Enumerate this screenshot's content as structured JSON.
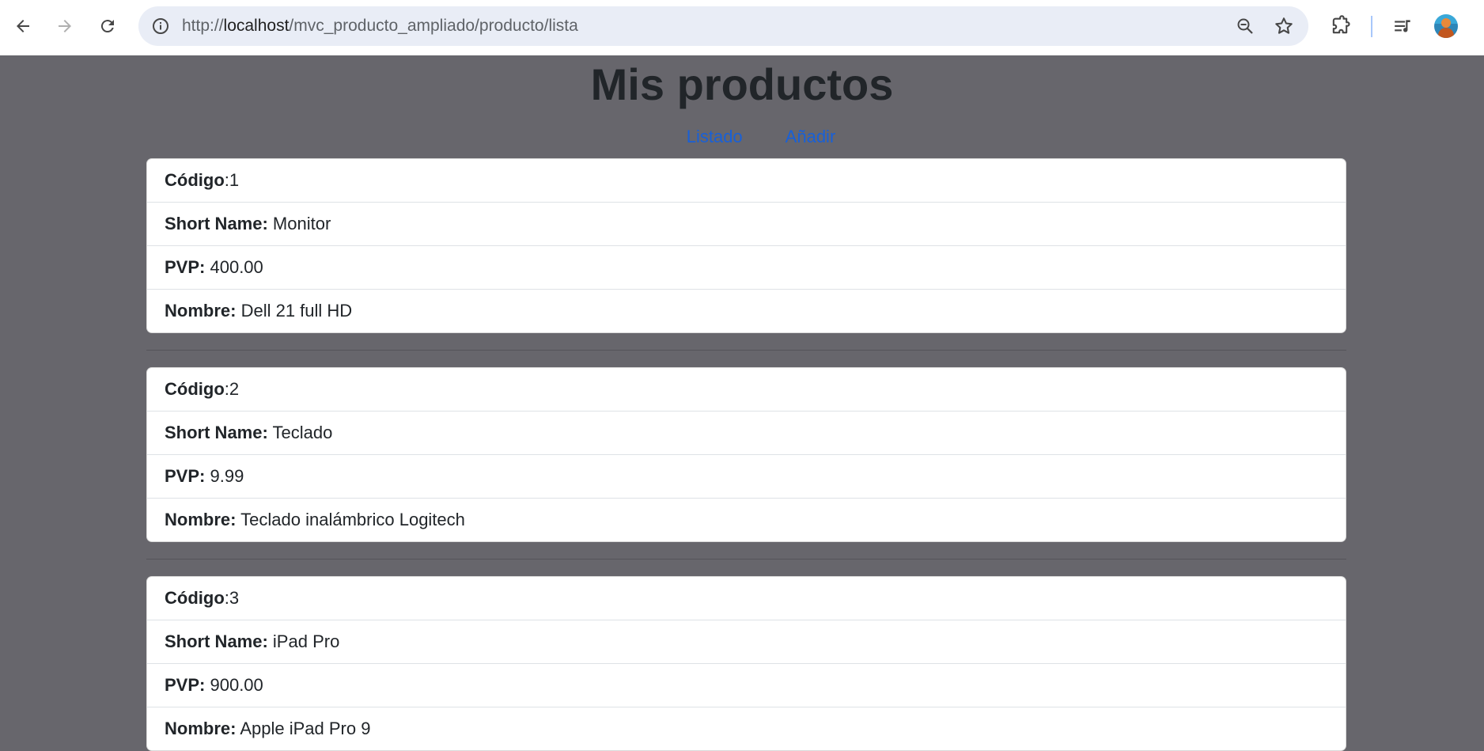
{
  "browser": {
    "url_prefix": "http://",
    "url_host": "localhost",
    "url_path": "/mvc_producto_ampliado/producto/lista"
  },
  "page": {
    "title": "Mis productos",
    "nav": {
      "list_label": "Listado",
      "add_label": "Añadir"
    }
  },
  "labels": {
    "code": "Código",
    "code_sep": ":",
    "short_name": "Short Name:",
    "price": "PVP:",
    "name": "Nombre:"
  },
  "products": [
    {
      "code": "1",
      "short_name": "Monitor",
      "price": "400.00",
      "name": "Dell 21 full HD"
    },
    {
      "code": "2",
      "short_name": "Teclado",
      "price": "9.99",
      "name": "Teclado inalámbrico Logitech"
    },
    {
      "code": "3",
      "short_name": "iPad Pro",
      "price": "900.00",
      "name": "Apple iPad Pro 9"
    }
  ],
  "colors": {
    "page_background": "#67666c",
    "link": "#1860d8",
    "omnibox": "#e9edf6"
  }
}
